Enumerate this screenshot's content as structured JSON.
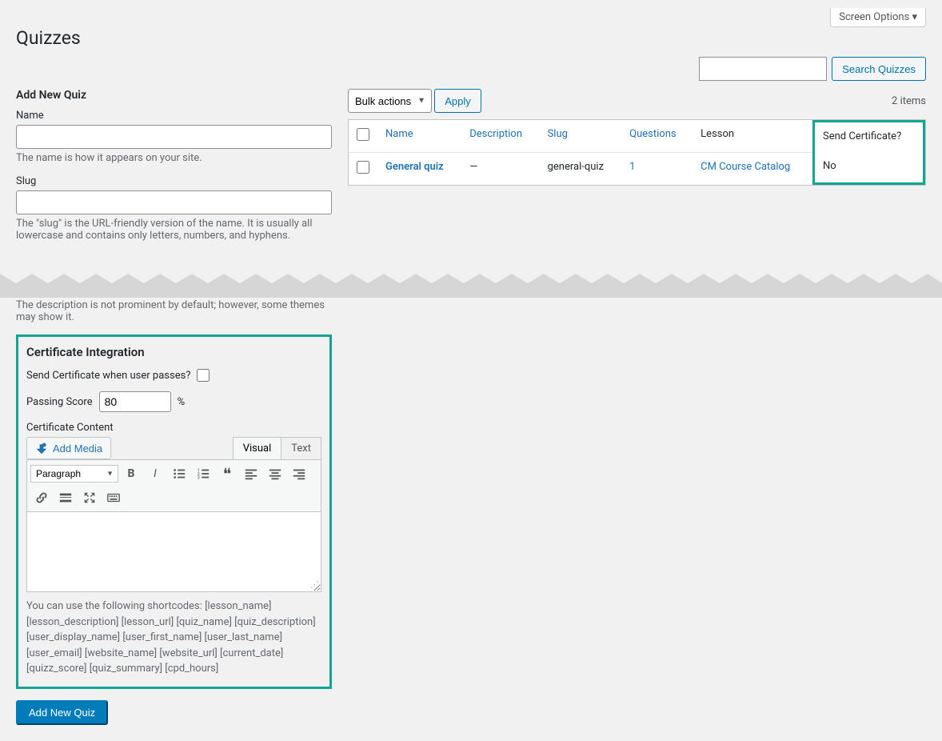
{
  "header": {
    "screen_options": "Screen Options ▾",
    "page_title": "Quizzes",
    "search_button": "Search Quizzes"
  },
  "form": {
    "section_title": "Add New Quiz",
    "name_label": "Name",
    "name_desc": "The name is how it appears on your site.",
    "slug_label": "Slug",
    "slug_desc": "The \"slug\" is the URL-friendly version of the name. It is usually all lowercase and contains only letters, numbers, and hyphens.",
    "desc_cutoff": "The description is not prominent by default; however, some themes may show it.",
    "submit": "Add New Quiz"
  },
  "cert": {
    "title": "Certificate Integration",
    "send_label": "Send Certificate when user passes?",
    "score_label": "Passing Score",
    "score_value": "80",
    "percent": "%",
    "content_label": "Certificate Content",
    "add_media": "Add Media",
    "tab_visual": "Visual",
    "tab_text": "Text",
    "format_sel": "Paragraph",
    "shortcodes": "You can use the following shortcodes: [lesson_name] [lesson_description] [lesson_url] [quiz_name] [quiz_description] [user_display_name] [user_first_name] [user_last_name] [user_email] [website_name] [website_url] [current_date] [quizz_score] [quiz_summary] [cpd_hours]"
  },
  "table": {
    "bulk_label": "Bulk actions",
    "apply": "Apply",
    "items_count": "2 items",
    "cols": {
      "name": "Name",
      "desc": "Description",
      "slug": "Slug",
      "questions": "Questions",
      "lesson": "Lesson",
      "cert": "Send Certificate?"
    },
    "rows": [
      {
        "name": "General quiz",
        "desc": "—",
        "slug": "general-quiz",
        "questions": "1",
        "lesson": "CM Course Catalog",
        "cert": "No"
      }
    ]
  }
}
